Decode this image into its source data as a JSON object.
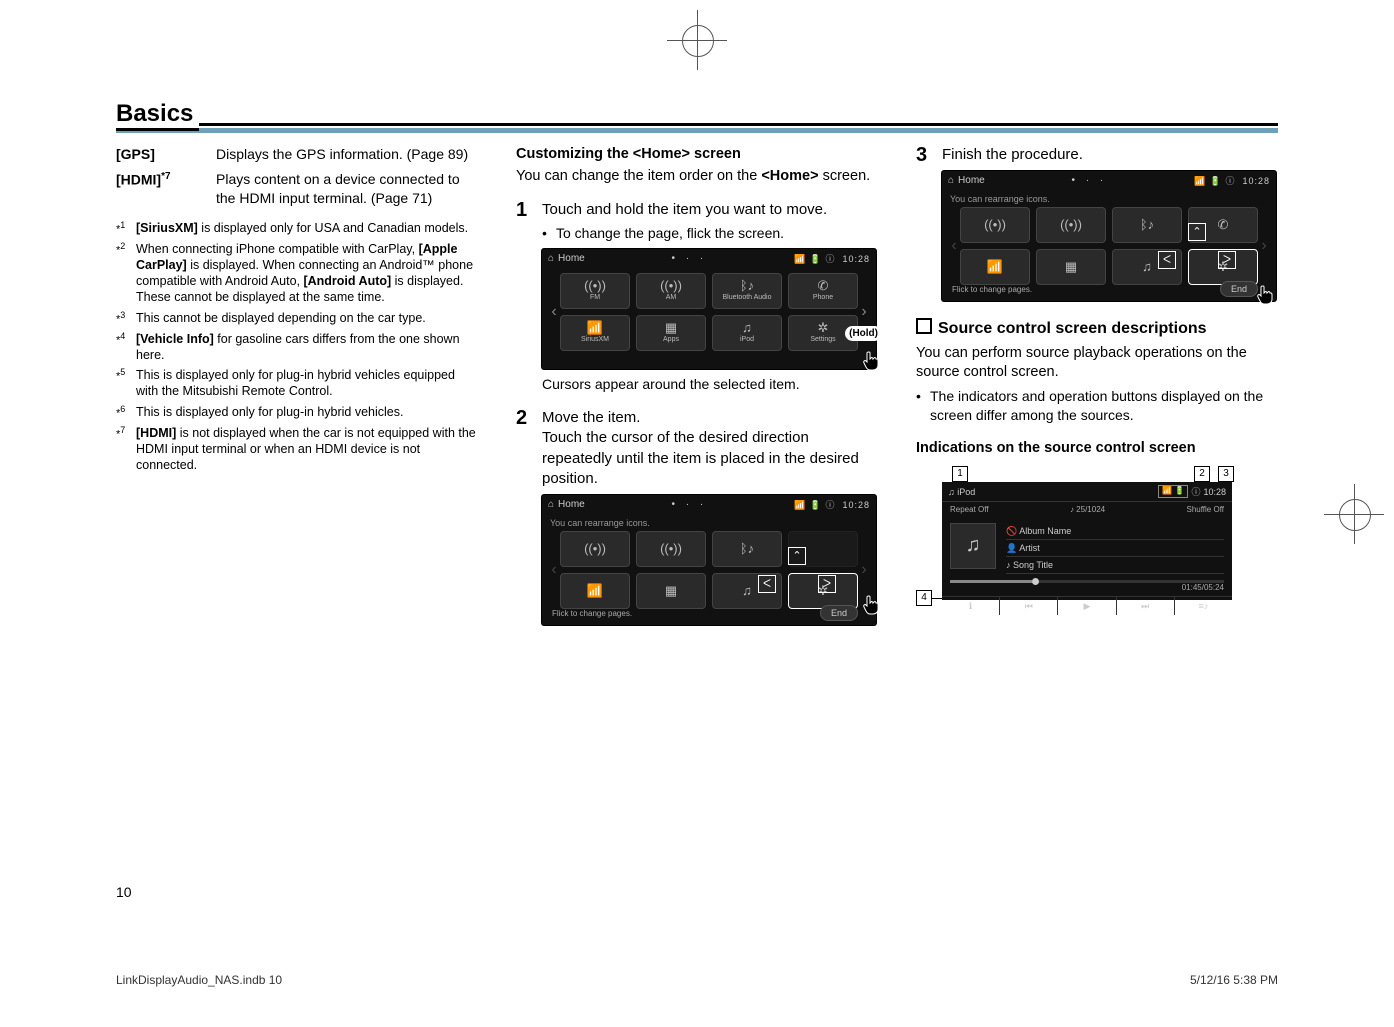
{
  "section_title": "Basics",
  "col1": {
    "defs": [
      {
        "term": "[GPS]",
        "desc": "Displays the GPS information. (Page 89)"
      },
      {
        "term_html": "[HDMI]*7",
        "term": "[HDMI]",
        "term_sup": "*7",
        "desc": "Plays content on a device connected to the HDMI input terminal. (Page 71)"
      }
    ],
    "footnotes": [
      {
        "mark": "*1",
        "bold": "[SiriusXM]",
        "rest": " is displayed only for USA and Canadian models."
      },
      {
        "mark": "*2",
        "text": "When connecting iPhone compatible with CarPlay, ",
        "bold1": "[Apple CarPlay]",
        "mid": " is displayed. When connecting an Android™ phone compatible with Android Auto, ",
        "bold2": "[Android Auto]",
        "end": " is displayed. These cannot be displayed at the same time."
      },
      {
        "mark": "*3",
        "plain": "This cannot be displayed depending on the car type."
      },
      {
        "mark": "*4",
        "bold": "[Vehicle Info]",
        "rest": " for gasoline cars differs from the one shown here."
      },
      {
        "mark": "*5",
        "plain": "This is displayed only for plug-in hybrid vehicles equipped with the Mitsubishi Remote Control."
      },
      {
        "mark": "*6",
        "plain": "This is displayed only for plug-in hybrid vehicles."
      },
      {
        "mark": "*7",
        "bold": "[HDMI]",
        "rest": " is not displayed when the car is not equipped with the HDMI input terminal or when an HDMI device is not connected."
      }
    ]
  },
  "col2": {
    "subhead": "Customizing the <Home> screen",
    "intro_pre": "You can change the item order on the ",
    "intro_bold": "<Home>",
    "intro_post": " screen.",
    "step1": {
      "num": "1",
      "text": "Touch and hold the item you want to move.",
      "sub": "To change the page, flick the screen."
    },
    "shot1": {
      "title": "Home",
      "status": "10:28",
      "tiles": [
        "FM",
        "AM",
        "Bluetooth Audio",
        "Phone",
        "SiriusXM",
        "Apps",
        "iPod",
        "Settings"
      ],
      "hold": "(Hold)"
    },
    "after1": "Cursors appear around the selected item.",
    "step2": {
      "num": "2",
      "lead": "Move the item.",
      "text": "Touch the cursor of the desired direction repeatedly until the item is placed in the desired position."
    },
    "shot2": {
      "title": "Home",
      "hint": "You can rearrange icons.",
      "flick": "Flick to change pages.",
      "end": "End",
      "status": "10:28"
    }
  },
  "col3": {
    "step3": {
      "num": "3",
      "text": "Finish the procedure."
    },
    "shot3": {
      "title": "Home",
      "hint": "You can rearrange icons.",
      "flick": "Flick to change pages.",
      "end": "End",
      "status": "10:28"
    },
    "source_head": "Source control screen descriptions",
    "source_p1": "You can perform source playback operations on the source control screen.",
    "source_b1": "The indicators and operation buttons displayed on the screen differ among the sources.",
    "ind_head": "Indications on the source control screen",
    "callouts": [
      "1",
      "2",
      "3",
      "4"
    ],
    "src_fig": {
      "source": "iPod",
      "repeat": "Repeat Off",
      "track": "25/1024",
      "shuffle": "Shuffle Off",
      "album": "Album Name",
      "artist": "Artist",
      "song": "Song Title",
      "time": "01:45/05:24",
      "clock": "10:28"
    }
  },
  "page_num": "10",
  "footer_left": "LinkDisplayAudio_NAS.indb   10",
  "footer_right": "5/12/16   5:38 PM"
}
